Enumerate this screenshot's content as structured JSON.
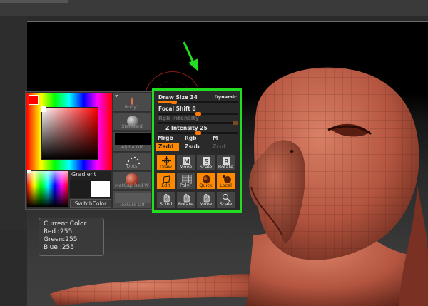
{
  "palette": {
    "gradient_label": "Gradient",
    "switch_color_label": "SwitchColor",
    "tiles": [
      {
        "label": "Body1",
        "icon": "mesh-tile-icon"
      },
      {
        "label": "Standard",
        "icon": "standard-brush-icon"
      },
      {
        "label": "Alpha Off",
        "icon": "alpha-icon"
      },
      {
        "label": "Dots",
        "icon": "dots-stroke-icon"
      },
      {
        "label": "MatCap Red W",
        "icon": "matcap-ball-icon"
      },
      {
        "label": "Texture Off",
        "icon": "texture-icon"
      }
    ],
    "main_color": "#ff0000",
    "secondary_color": "#ffffff"
  },
  "tool_panel": {
    "draw_size": {
      "label": "Draw Size 34",
      "fraction": 0.2
    },
    "dynamic_label": "Dynamic",
    "focal_shift": {
      "label": "Focal Shift 0",
      "fraction": 0.5
    },
    "rgb_intensity": {
      "label": "Rgb Intensity",
      "fraction": 1.0
    },
    "z_intensity": {
      "label": "Z Intensity 25",
      "fraction": 0.5
    },
    "modes_row1": {
      "mrgb": "Mrgb",
      "rgb": "Rgb",
      "m": "M"
    },
    "modes_row2": {
      "zadd": "Zadd",
      "zsub": "Zsub",
      "zcut": "Zcut"
    },
    "buttons_row1": [
      {
        "label": "Draw",
        "on": true,
        "icon": "draw-icon"
      },
      {
        "label": "Move",
        "on": false,
        "icon": "move-icon"
      },
      {
        "label": "Scale",
        "on": false,
        "icon": "scale-icon"
      },
      {
        "label": "Rotate",
        "on": false,
        "icon": "rotate-icon"
      }
    ],
    "buttons_row2": [
      {
        "label": "Edit",
        "on": true,
        "icon": "edit-icon"
      },
      {
        "label": "PolyF",
        "on": false,
        "icon": "polyframe-icon"
      },
      {
        "label": "Quick",
        "on": true,
        "icon": "quick-icon"
      },
      {
        "label": "Local",
        "on": true,
        "icon": "local-icon"
      }
    ],
    "buttons_row3": [
      {
        "label": "Scroll",
        "icon": "scroll-icon"
      },
      {
        "label": "Rotate",
        "icon": "rotate-view-icon"
      },
      {
        "label": "Move",
        "icon": "move-view-icon"
      },
      {
        "label": "Scale",
        "icon": "scale-view-icon"
      }
    ],
    "accent_color": "#ff8a00",
    "highlight_border": "#22dd22"
  },
  "tooltip": {
    "title": "Current Color",
    "red": "Red  :255",
    "green": "Green:255",
    "blue": "Blue :255"
  },
  "arrow_color": "#22dd22"
}
